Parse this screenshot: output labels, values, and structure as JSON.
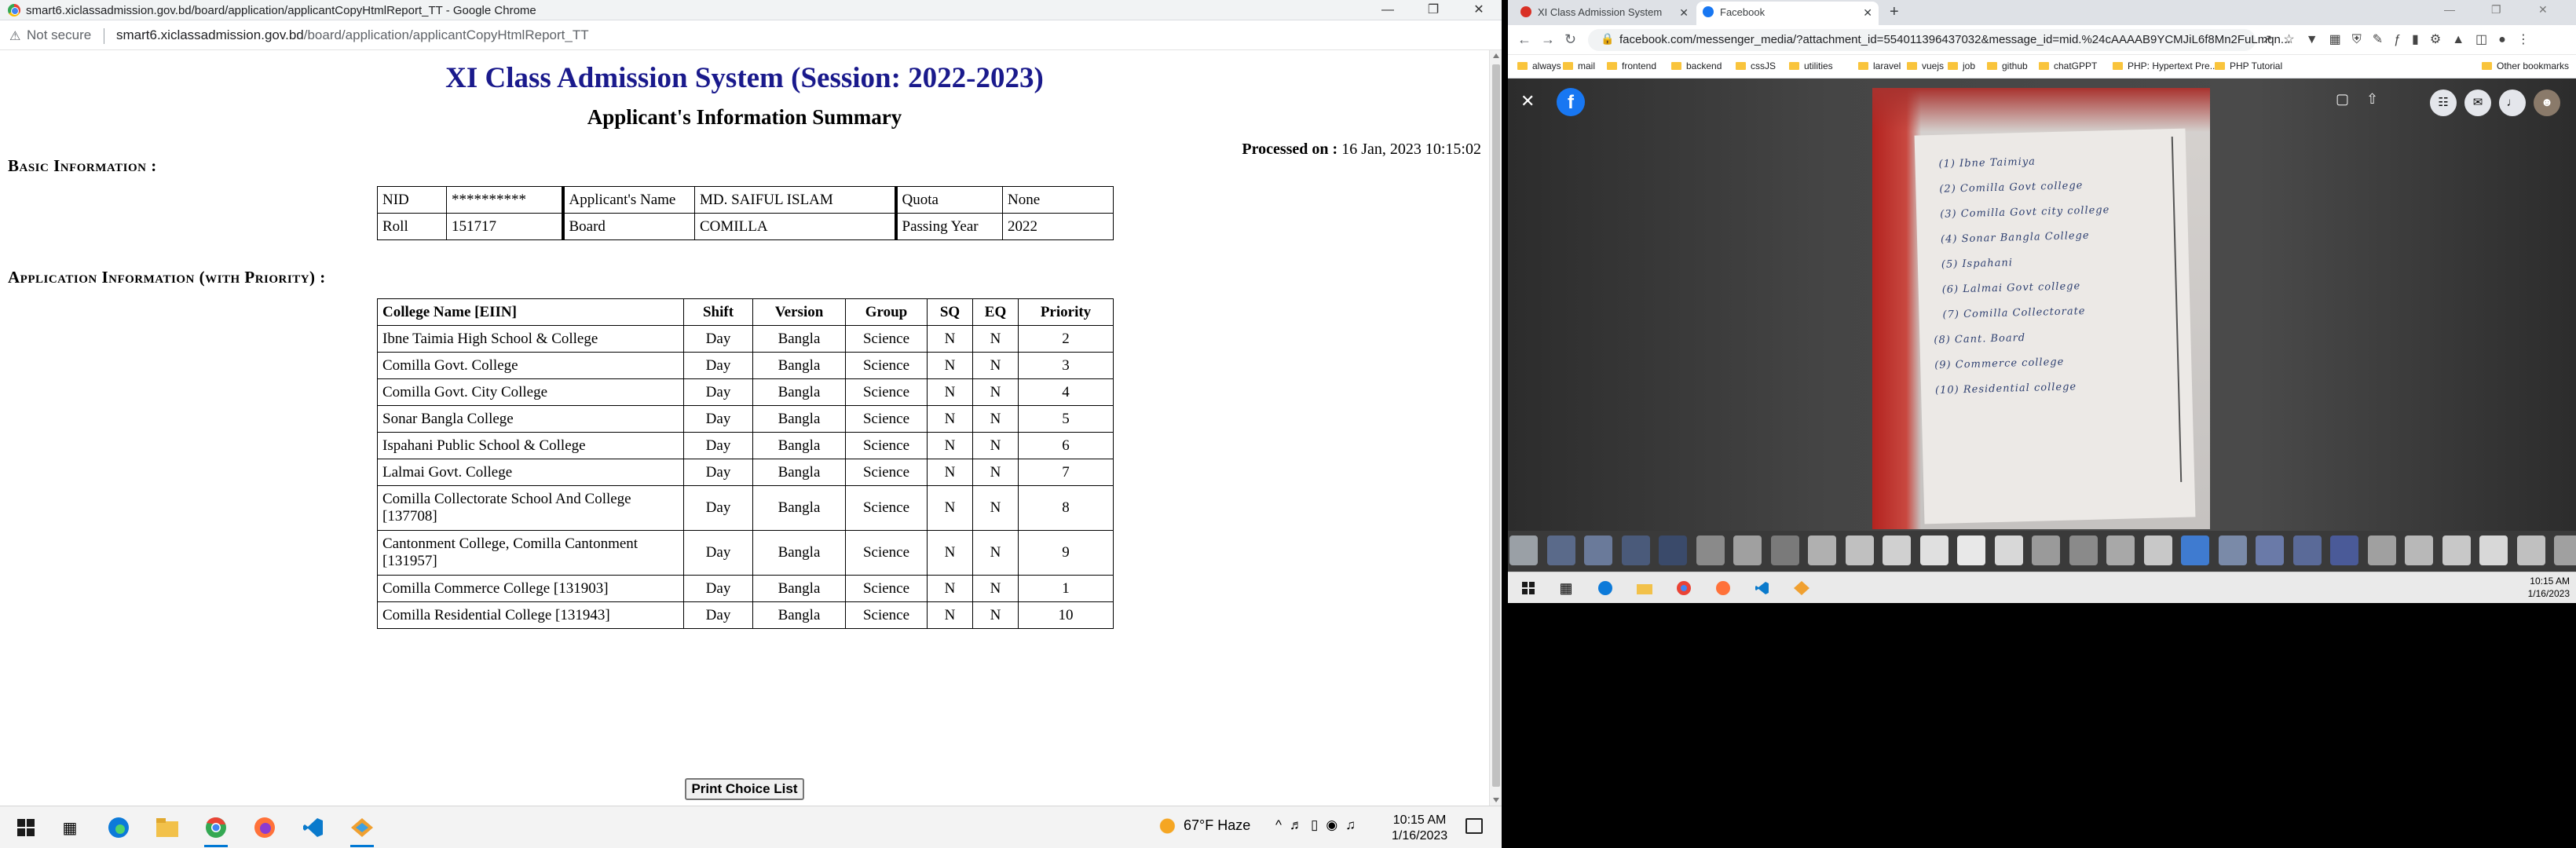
{
  "left_window": {
    "title": "smart6.xiclassadmission.gov.bd/board/application/applicantCopyHtmlReport_TT - Google Chrome",
    "not_secure": "Not secure",
    "url_host": "smart6.xiclassadmission.gov.bd",
    "url_path": "/board/application/applicantCopyHtmlReport_TT"
  },
  "report": {
    "title": "XI Class Admission System (Session: 2022-2023)",
    "subtitle": "Applicant's Information Summary",
    "processed_label": "Processed on :",
    "processed_value": "16 Jan, 2023 10:15:02",
    "basic_heading": "Basic Information :",
    "application_heading": "Application Information (with Priority) :",
    "basic": {
      "nid_label": "NID",
      "nid_value": "**********",
      "name_label": "Applicant's Name",
      "name_value": "MD. SAIFUL ISLAM",
      "quota_label": "Quota",
      "quota_value": "None",
      "roll_label": "Roll",
      "roll_value": "151717",
      "board_label": "Board",
      "board_value": "COMILLA",
      "year_label": "Passing Year",
      "year_value": "2022"
    },
    "columns": [
      "College Name [EIIN]",
      "Shift",
      "Version",
      "Group",
      "SQ",
      "EQ",
      "Priority"
    ],
    "rows": [
      {
        "college": "Ibne Taimia High School & College",
        "shift": "Day",
        "version": "Bangla",
        "group": "Science",
        "sq": "N",
        "eq": "N",
        "priority": "2"
      },
      {
        "college": "Comilla Govt. College",
        "shift": "Day",
        "version": "Bangla",
        "group": "Science",
        "sq": "N",
        "eq": "N",
        "priority": "3"
      },
      {
        "college": "Comilla Govt. City College",
        "shift": "Day",
        "version": "Bangla",
        "group": "Science",
        "sq": "N",
        "eq": "N",
        "priority": "4"
      },
      {
        "college": "Sonar Bangla College",
        "shift": "Day",
        "version": "Bangla",
        "group": "Science",
        "sq": "N",
        "eq": "N",
        "priority": "5"
      },
      {
        "college": "Ispahani Public School & College",
        "shift": "Day",
        "version": "Bangla",
        "group": "Science",
        "sq": "N",
        "eq": "N",
        "priority": "6"
      },
      {
        "college": "Lalmai Govt. College",
        "shift": "Day",
        "version": "Bangla",
        "group": "Science",
        "sq": "N",
        "eq": "N",
        "priority": "7"
      },
      {
        "college": "Comilla Collectorate School And College [137708]",
        "shift": "Day",
        "version": "Bangla",
        "group": "Science",
        "sq": "N",
        "eq": "N",
        "priority": "8"
      },
      {
        "college": "Cantonment College, Comilla Cantonment [131957]",
        "shift": "Day",
        "version": "Bangla",
        "group": "Science",
        "sq": "N",
        "eq": "N",
        "priority": "9"
      },
      {
        "college": "Comilla Commerce College [131903]",
        "shift": "Day",
        "version": "Bangla",
        "group": "Science",
        "sq": "N",
        "eq": "N",
        "priority": "1"
      },
      {
        "college": "Comilla Residential College [131943]",
        "shift": "Day",
        "version": "Bangla",
        "group": "Science",
        "sq": "N",
        "eq": "N",
        "priority": "10"
      }
    ],
    "print_button": "Print Choice List"
  },
  "left_taskbar": {
    "weather": "67°F  Haze",
    "time": "10:15 AM",
    "date": "1/16/2023"
  },
  "right_window": {
    "tabs": [
      {
        "label": "XI Class Admission System",
        "favicon_color": "#d93025"
      },
      {
        "label": "Facebook",
        "favicon_color": "#1877f2"
      }
    ],
    "url": "facebook.com/messenger_media/?attachment_id=554011396437032&message_id=mid.%24cAAAAB9YCMJiL6f8Mn2FuLmqn...",
    "bookmarks": [
      "always",
      "mail",
      "frontend",
      "backend",
      "cssJS",
      "utilities",
      "laravel",
      "vuejs",
      "job",
      "github",
      "chatGPPT",
      "PHP: Hypertext Pre...",
      "PHP Tutorial",
      "Other bookmarks"
    ],
    "handwritten_list": [
      "Ibne Taimiya",
      "Comilla Govt college",
      "Comilla Govt city college",
      "Sonar Bangla College",
      "Ispahani",
      "Lalmai Govt college",
      "Comilla Collectorate",
      "Cant. Board",
      "Commerce college",
      "Residential college"
    ],
    "time": "10:15 AM",
    "date": "1/16/2023"
  }
}
